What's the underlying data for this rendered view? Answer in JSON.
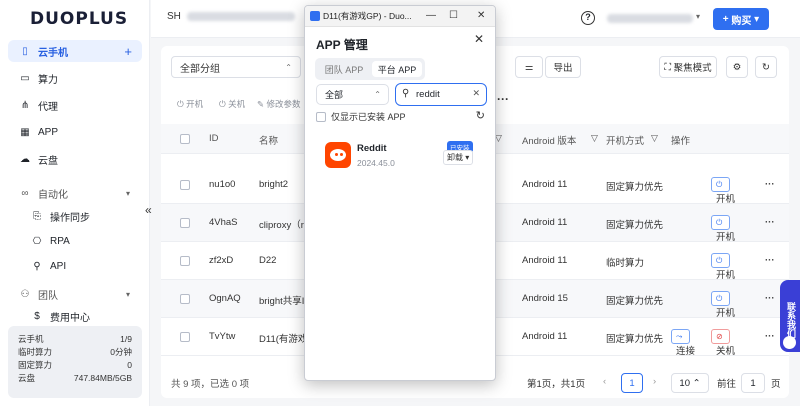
{
  "brand": {
    "logo": "DUOPLUS"
  },
  "sidebar": {
    "items": [
      {
        "label": "云手机",
        "icon": "phone-icon",
        "active": true
      },
      {
        "label": "算力",
        "icon": "monitor-icon"
      },
      {
        "label": "代理",
        "icon": "proxy-icon"
      },
      {
        "label": "APP",
        "icon": "grid-icon"
      },
      {
        "label": "云盘",
        "icon": "cloud-icon"
      }
    ],
    "automation": {
      "label": "自动化",
      "icon": "infinity-icon",
      "children": [
        "操作同步",
        "RPA",
        "API"
      ]
    },
    "team": {
      "label": "团队",
      "icon": "team-icon",
      "children": [
        "费用中心"
      ]
    },
    "stats": [
      {
        "label": "云手机",
        "value": "1/9"
      },
      {
        "label": "临时算力",
        "value": "0分钟"
      },
      {
        "label": "固定算力",
        "value": "0"
      },
      {
        "label": "云盘",
        "value": "747.84MB/5GB"
      }
    ]
  },
  "topbar": {
    "device_prefix": "SH",
    "buy_label": "购买"
  },
  "toolbar": {
    "group_select": "全部分组",
    "export_label": "导出",
    "focus_mode_label": "聚焦模式",
    "actions": [
      "开机",
      "关机",
      "修改参数"
    ]
  },
  "table": {
    "headers": [
      "ID",
      "名称",
      "Android 版本",
      "开机方式",
      "操作"
    ],
    "rows": [
      {
        "id": "nu1o0",
        "name": "bright2",
        "android": "Android 11",
        "boot": "固定算力优先",
        "ops": [
          "开机"
        ]
      },
      {
        "id": "4VhaS",
        "name": "cliproxy（r",
        "android": "Android 11",
        "boot": "固定算力优先",
        "ops": [
          "开机"
        ]
      },
      {
        "id": "zf2xD",
        "name": "D22",
        "android": "Android 11",
        "boot": "临时算力",
        "ops": [
          "开机"
        ]
      },
      {
        "id": "OgnAQ",
        "name": "bright共享I",
        "android": "Android 15",
        "boot": "固定算力优先",
        "ops": [
          "开机"
        ]
      },
      {
        "id": "TvYtw",
        "name": "D11(有游戏(",
        "android": "Android 11",
        "boot": "固定算力优先",
        "ops": [
          "连接",
          "关机"
        ]
      }
    ]
  },
  "footer": {
    "summary": "共 9 项，已选 0 项",
    "page_info": "第1页，共1页",
    "current_page": "1",
    "page_size": "10",
    "goto_label": "前往",
    "goto_value": "1",
    "page_suffix": "页"
  },
  "float_panel": {
    "label": "联系我们"
  },
  "modal": {
    "window_title": "D11(有游戏GP) - Duo...",
    "heading": "APP 管理",
    "tabs": [
      "团队 APP",
      "平台 APP"
    ],
    "active_tab": 1,
    "filter": "全部",
    "search_value": "reddit",
    "only_installed_label": "仅显示已安装 APP",
    "app": {
      "name": "Reddit",
      "version": "2024.45.0",
      "badge": "已安装",
      "action": "卸载"
    }
  },
  "colors": {
    "primary": "#2f6ff0",
    "danger": "#e04545",
    "reddit": "#ff4500"
  }
}
